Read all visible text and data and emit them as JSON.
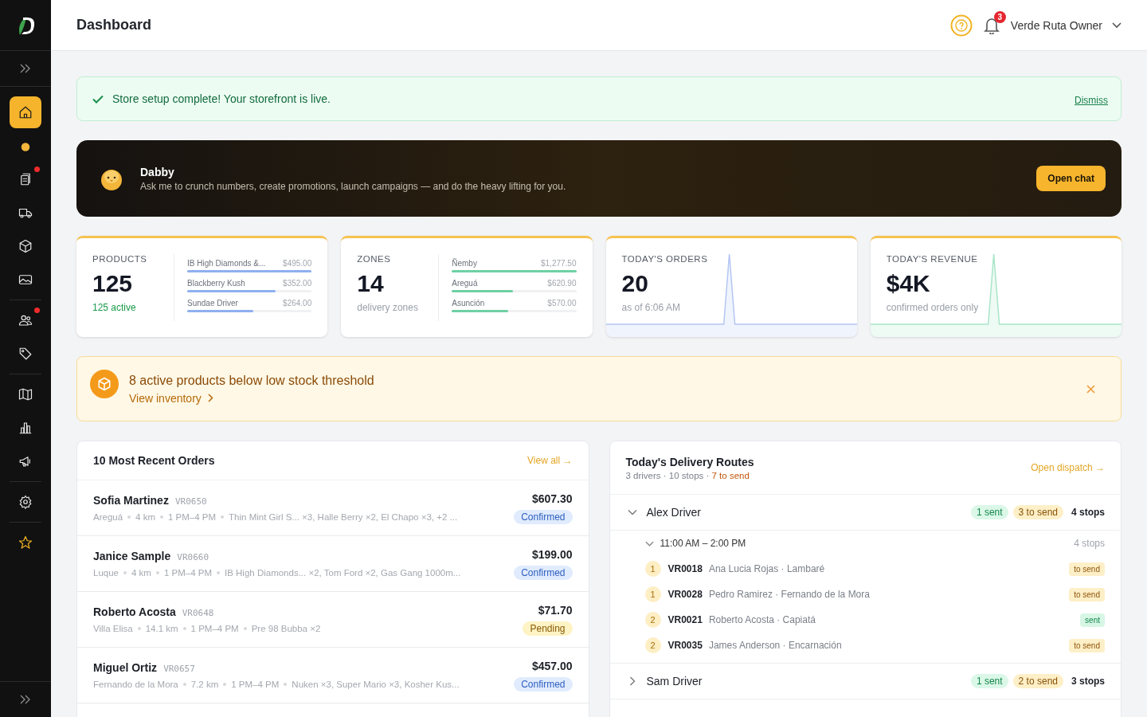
{
  "sidebar": {
    "items": [
      {
        "selected": true,
        "dot": false
      },
      {
        "selected": false,
        "dot": false
      },
      {
        "selected": false,
        "dot": true
      },
      {
        "selected": false,
        "dot": false
      },
      {
        "selected": false,
        "dot": false
      },
      {
        "selected": false,
        "dot": false
      },
      {
        "selected": false,
        "dot": true
      },
      {
        "selected": false,
        "dot": false
      },
      {
        "selected": false,
        "dot": false
      },
      {
        "selected": false,
        "dot": false
      },
      {
        "selected": false,
        "dot": false
      },
      {
        "selected": false,
        "dot": false
      },
      {
        "selected": false,
        "dot": false
      }
    ]
  },
  "header": {
    "title": "Dashboard",
    "notifications": "3",
    "user": "Verde Ruta Owner"
  },
  "success_banner": {
    "message": "Store setup complete! Your storefront is live.",
    "dismiss": "Dismiss"
  },
  "assistant": {
    "name": "Dabby",
    "text": "Ask me to crunch numbers, create promotions, launch campaigns — and do the heavy lifting for you.",
    "button": "Open chat"
  },
  "stats": [
    {
      "kind": "bars",
      "label": "PRODUCTS",
      "value": "125",
      "sub": "125 active",
      "sub_highlighted": true,
      "color": "#8fb0f0",
      "bars": [
        {
          "name": "IB High Diamonds &...",
          "amount": "$495.00",
          "level": 1
        },
        {
          "name": "Blackberry Kush",
          "amount": "$352.00",
          "level": 0.71
        },
        {
          "name": "Sundae Driver",
          "amount": "$264.00",
          "level": 0.53
        }
      ]
    },
    {
      "kind": "bars",
      "label": "ZONES",
      "value": "14",
      "sub": "delivery zones",
      "sub_highlighted": false,
      "color": "#6fd0a4",
      "bars": [
        {
          "name": "Ñemby",
          "amount": "$1,277.50",
          "level": 1
        },
        {
          "name": "Areguá",
          "amount": "$620.90",
          "level": 0.49
        },
        {
          "name": "Asunción",
          "amount": "$570.00",
          "level": 0.45
        }
      ]
    },
    {
      "kind": "sparkline",
      "label": "TODAY'S ORDERS",
      "value": "20",
      "sub": "as of 6:06 AM",
      "sub_highlighted": false,
      "color": "#b4c6f3"
    },
    {
      "kind": "sparkline",
      "label": "TODAY'S REVENUE",
      "value": "$4K",
      "sub": "confirmed orders only",
      "sub_highlighted": false,
      "color": "#a9e6c9"
    }
  ],
  "stock_alert": {
    "message": "8 active products below low stock threshold",
    "link": "View inventory"
  },
  "orders": {
    "title": "10 Most Recent Orders",
    "link": "View all →",
    "rows": [
      {
        "name": "Sofia Martinez",
        "id": "VR0650",
        "meta": [
          "Areguá",
          "4 km",
          "1 PM–4 PM",
          "Thin Mint Girl S... ×3, Halle Berry ×2, El Chapo ×3, +2 ..."
        ],
        "total": "$607.30",
        "status": "Confirmed",
        "kind": "confirmed"
      },
      {
        "name": "Janice Sample",
        "id": "VR0660",
        "meta": [
          "Luque",
          "4 km",
          "1 PM–4 PM",
          "IB High Diamonds... ×2, Tom Ford ×2, Gas Gang 1000m..."
        ],
        "total": "$199.00",
        "status": "Confirmed",
        "kind": "confirmed"
      },
      {
        "name": "Roberto Acosta",
        "id": "VR0648",
        "meta": [
          "Villa Elisa",
          "14.1 km",
          "1 PM–4 PM",
          "Pre 98 Bubba ×2"
        ],
        "total": "$71.70",
        "status": "Pending",
        "kind": "pending"
      },
      {
        "name": "Miguel Ortiz",
        "id": "VR0657",
        "meta": [
          "Fernando de la Mora",
          "7.2 km",
          "1 PM–4 PM",
          "Nuken ×3, Super Mario ×3, Kosher Kus..."
        ],
        "total": "$457.00",
        "status": "Confirmed",
        "kind": "confirmed"
      }
    ]
  },
  "routes": {
    "title": "Today's Delivery Routes",
    "summary": "3 drivers · 10 stops · ",
    "summary_alert": "7 to send",
    "link": "Open dispatch →",
    "drivers": [
      {
        "name": "Alex Driver",
        "expanded": true,
        "sent": "1 sent",
        "to_send": "3 to send",
        "stops": "4 stops",
        "slots": [
          {
            "time": "11:00 AM – 2:00 PM",
            "stops": "4 stops",
            "expanded": true,
            "items": [
              {
                "seq": "1",
                "id": "VR0018",
                "desc": "Ana Lucia Rojas · Lambaré",
                "status": "to send",
                "kind": "pending"
              },
              {
                "seq": "1",
                "id": "VR0028",
                "desc": "Pedro Ramirez · Fernando de la Mora",
                "status": "to send",
                "kind": "pending"
              },
              {
                "seq": "2",
                "id": "VR0021",
                "desc": "Roberto Acosta · Capiatá",
                "status": "sent",
                "kind": "sent"
              },
              {
                "seq": "2",
                "id": "VR0035",
                "desc": "James Anderson · Encarnación",
                "status": "to send",
                "kind": "pending"
              }
            ]
          }
        ]
      },
      {
        "name": "Sam Driver",
        "expanded": false,
        "sent": "1 sent",
        "to_send": "2 to send",
        "stops": "3 stops"
      }
    ]
  }
}
